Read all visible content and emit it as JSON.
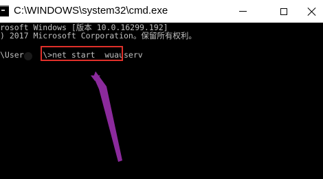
{
  "window": {
    "title": "C:\\WINDOWS\\system32\\cmd.exe",
    "icon": "cmd-icon"
  },
  "controls": {
    "minimize": "minimize-icon",
    "maximize": "maximize-icon",
    "close": "close-icon"
  },
  "console": {
    "lines": [
      "rosoft Windows [版本 10.0.16299.192]",
      ") 2017 Microsoft Corporation。保留所有权利。",
      "\\User    \\>net start  wuauserv"
    ]
  },
  "annotation": {
    "highlight_color": "#e0302a",
    "arrow_color": "#8b2a9c"
  }
}
